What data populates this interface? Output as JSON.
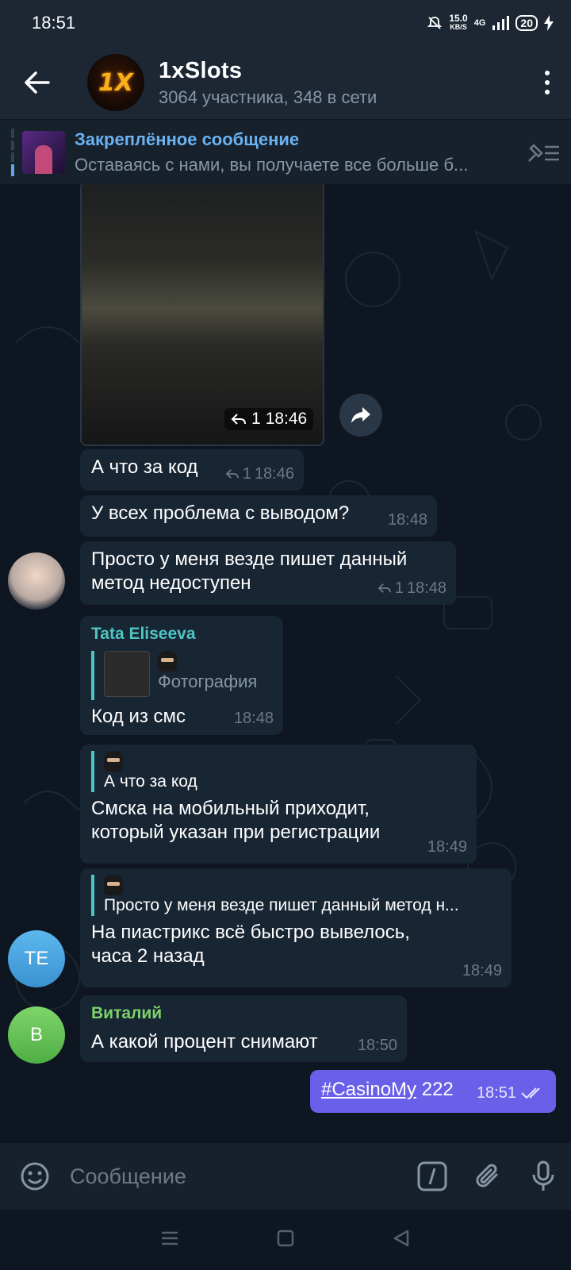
{
  "status": {
    "time": "18:51",
    "speed_value": "15.0",
    "speed_unit": "KB/S",
    "network": "4G",
    "battery": "20"
  },
  "header": {
    "title": "1xSlots",
    "subtitle": "3064 участника, 348 в сети",
    "avatar_text": "1X"
  },
  "pinned": {
    "title": "Закреплённое сообщение",
    "message": "Оставаясь с нами, вы получаете все больше б..."
  },
  "media": {
    "replies": "1",
    "time": "18:46"
  },
  "messages": [
    {
      "text": "А что за код",
      "replies": "1",
      "time": "18:46"
    },
    {
      "text": "У всех проблема с выводом?",
      "time": "18:48"
    },
    {
      "text": "Просто у меня везде пишет данный метод недоступен",
      "replies": "1",
      "time": "18:48"
    },
    {
      "sender": "Tata Eliseeva",
      "reply_label": "Фотография",
      "text": "Код из смс",
      "time": "18:48"
    },
    {
      "reply_text": "А что за код",
      "text": "Смска на мобильный приходит, который указан при регистрации",
      "time": "18:49"
    },
    {
      "reply_text": "Просто у меня везде пишет данный метод н...",
      "text": "На пиастрикс всё быстро вывелось, часа 2 назад",
      "time": "18:49"
    },
    {
      "sender": "Виталий",
      "text": "А какой процент снимают",
      "time": "18:50"
    }
  ],
  "avatars": {
    "te": "TE",
    "v": "В"
  },
  "own_message": {
    "hashtag": "#CasinoMy",
    "text": " 222",
    "time": "18:51"
  },
  "input": {
    "placeholder": "Сообщение"
  },
  "colors": {
    "accent": "#6ab2f2",
    "own_bubble": "#6a5fe8",
    "bubble": "#182533",
    "tata": "#4fc4c4",
    "vitaly": "#7cd26a"
  }
}
